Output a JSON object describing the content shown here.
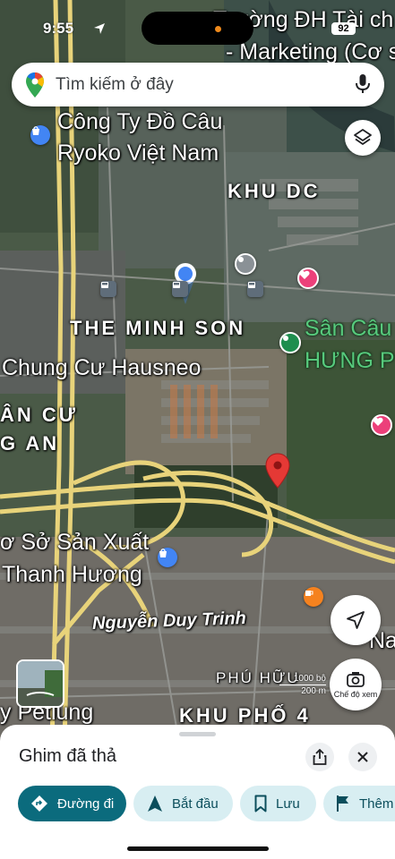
{
  "status_bar": {
    "time": "9:55",
    "battery": "92"
  },
  "search": {
    "placeholder": "Tìm kiếm ở đây"
  },
  "map_labels": {
    "truong_dh_line1": "Trường ĐH Tài ch",
    "truong_dh_line2": "- Marketing (Cơ s",
    "cong_ty_line1": "Công Ty Đồ Câu",
    "cong_ty_line2": "Ryoko Việt Nam",
    "khu_dc": "KHU DC",
    "the_minh_son": "THE MINH SON",
    "san_cau_line1": "Sân Câu",
    "san_cau_line2": "HƯNG P",
    "chung_cu": "Chung Cư Hausneo",
    "an_cu": "ÂN CƯ",
    "g_an": "G AN",
    "co_so_line1": "ơ Sở Sản Xuất",
    "co_so_line2": "Thanh Hương",
    "nguyen_duy_trinh": "Nguyễn Duy Trinh",
    "na": "Na",
    "phu_huu": "PHÚ HỮU",
    "khu_pho_4": "KHU PHỐ 4",
    "y_petlung": "y Petlung"
  },
  "scale": {
    "text1": "1000 bộ",
    "text2": "200 m"
  },
  "street_view": {
    "label": "Chế độ xem"
  },
  "sheet": {
    "title": "Ghim đã thả",
    "chips": {
      "directions": "Đường đi",
      "start": "Bắt đầu",
      "save": "Lưu",
      "more": "Thêm"
    }
  },
  "colors": {
    "accent": "#0b6b7d",
    "chip_secondary": "#d8eef2",
    "pin_red": "#e53935",
    "road_yellow": "#e8d37a",
    "green_place": "#57c97c"
  },
  "icons": [
    "google-maps-logo-icon",
    "microphone-icon",
    "layers-icon",
    "navigation-arrow-icon",
    "street-view-icon",
    "share-icon",
    "close-icon",
    "directions-icon",
    "start-arrow-icon",
    "bookmark-icon",
    "flag-icon"
  ]
}
